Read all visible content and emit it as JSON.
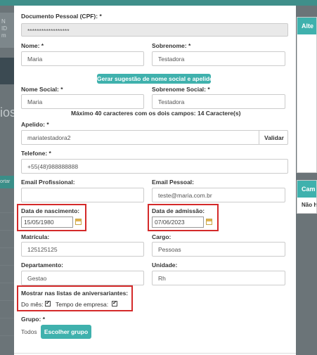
{
  "background": {
    "left_card_text": "N\nID\nm",
    "left_heading": "ios",
    "left_button": "ortar",
    "right_card1_title": "Alte",
    "right_card2_title": "Cam",
    "right_card2_text": "Não h"
  },
  "form": {
    "cpf": {
      "label": "Documento Pessoal (CPF): *",
      "value": "******************"
    },
    "nome": {
      "label": "Nome: *",
      "value": "Maria"
    },
    "sobrenome": {
      "label": "Sobrenome: *",
      "value": "Testadora"
    },
    "suggest_button": "Gerar sugestão de nome social e apelido",
    "nome_social": {
      "label": "Nome Social: *",
      "value": "Maria"
    },
    "sobrenome_social": {
      "label": "Sobrenome Social: *",
      "value": "Testadora"
    },
    "char_note": "Máximo 40 caracteres com os dois campos: 14 Caractere(s)",
    "apelido": {
      "label": "Apelido: *",
      "value": "mariatestadora2",
      "validate_label": "Validar"
    },
    "telefone": {
      "label": "Telefone: *",
      "value": "+55(48)988888888"
    },
    "email_profissional": {
      "label": "Email Profissional:",
      "value": ""
    },
    "email_pessoal": {
      "label": "Email Pessoal:",
      "value": "teste@maria.com.br"
    },
    "data_nascimento": {
      "label": "Data de nascimento:",
      "value": "15/05/1980"
    },
    "data_admissao": {
      "label": "Data de admissão:",
      "value": "07/06/2023"
    },
    "matricula": {
      "label": "Matrícula:",
      "value": "125125125"
    },
    "cargo": {
      "label": "Cargo:",
      "value": "Pessoas"
    },
    "departamento": {
      "label": "Departamento:",
      "value": "Gestao"
    },
    "unidade": {
      "label": "Unidade:",
      "value": "Rh"
    },
    "aniversariantes": {
      "label": "Mostrar nas listas de aniversariantes:",
      "do_mes_label": "Do mês:",
      "do_mes_checked": true,
      "tempo_empresa_label": "Tempo de empresa:",
      "tempo_empresa_checked": true
    },
    "grupo": {
      "label": "Grupo: *",
      "value": "Todos",
      "button": "Escolher grupo"
    }
  },
  "colors": {
    "accent": "#3fb1ad",
    "highlight": "#d42a2a",
    "overlay": "#6b7478"
  }
}
